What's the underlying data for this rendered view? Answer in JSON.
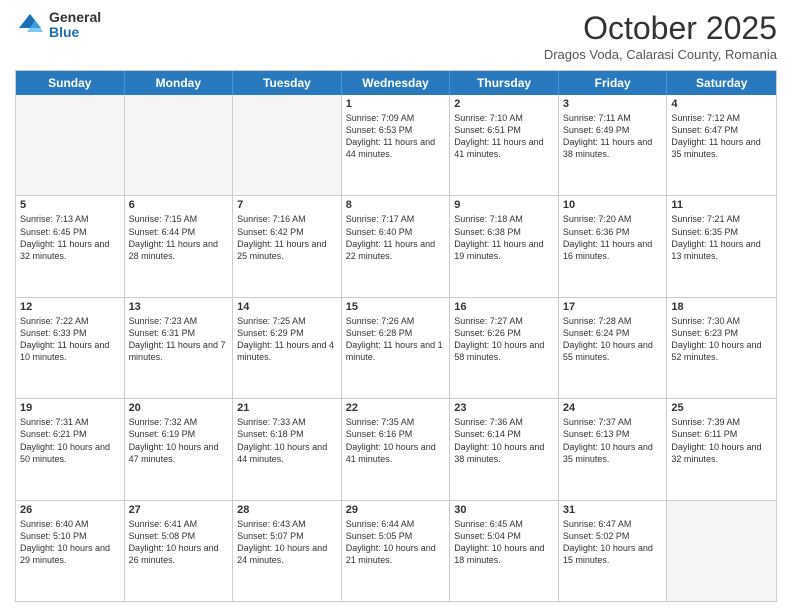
{
  "logo": {
    "general": "General",
    "blue": "Blue"
  },
  "header": {
    "month": "October 2025",
    "location": "Dragos Voda, Calarasi County, Romania"
  },
  "days": [
    "Sunday",
    "Monday",
    "Tuesday",
    "Wednesday",
    "Thursday",
    "Friday",
    "Saturday"
  ],
  "rows": [
    [
      {
        "day": "",
        "empty": true
      },
      {
        "day": "",
        "empty": true
      },
      {
        "day": "",
        "empty": true
      },
      {
        "day": "1",
        "sunrise": "7:09 AM",
        "sunset": "6:53 PM",
        "daylight": "11 hours and 44 minutes."
      },
      {
        "day": "2",
        "sunrise": "7:10 AM",
        "sunset": "6:51 PM",
        "daylight": "11 hours and 41 minutes."
      },
      {
        "day": "3",
        "sunrise": "7:11 AM",
        "sunset": "6:49 PM",
        "daylight": "11 hours and 38 minutes."
      },
      {
        "day": "4",
        "sunrise": "7:12 AM",
        "sunset": "6:47 PM",
        "daylight": "11 hours and 35 minutes."
      }
    ],
    [
      {
        "day": "5",
        "sunrise": "7:13 AM",
        "sunset": "6:45 PM",
        "daylight": "11 hours and 32 minutes."
      },
      {
        "day": "6",
        "sunrise": "7:15 AM",
        "sunset": "6:44 PM",
        "daylight": "11 hours and 28 minutes."
      },
      {
        "day": "7",
        "sunrise": "7:16 AM",
        "sunset": "6:42 PM",
        "daylight": "11 hours and 25 minutes."
      },
      {
        "day": "8",
        "sunrise": "7:17 AM",
        "sunset": "6:40 PM",
        "daylight": "11 hours and 22 minutes."
      },
      {
        "day": "9",
        "sunrise": "7:18 AM",
        "sunset": "6:38 PM",
        "daylight": "11 hours and 19 minutes."
      },
      {
        "day": "10",
        "sunrise": "7:20 AM",
        "sunset": "6:36 PM",
        "daylight": "11 hours and 16 minutes."
      },
      {
        "day": "11",
        "sunrise": "7:21 AM",
        "sunset": "6:35 PM",
        "daylight": "11 hours and 13 minutes."
      }
    ],
    [
      {
        "day": "12",
        "sunrise": "7:22 AM",
        "sunset": "6:33 PM",
        "daylight": "11 hours and 10 minutes."
      },
      {
        "day": "13",
        "sunrise": "7:23 AM",
        "sunset": "6:31 PM",
        "daylight": "11 hours and 7 minutes."
      },
      {
        "day": "14",
        "sunrise": "7:25 AM",
        "sunset": "6:29 PM",
        "daylight": "11 hours and 4 minutes."
      },
      {
        "day": "15",
        "sunrise": "7:26 AM",
        "sunset": "6:28 PM",
        "daylight": "11 hours and 1 minute."
      },
      {
        "day": "16",
        "sunrise": "7:27 AM",
        "sunset": "6:26 PM",
        "daylight": "10 hours and 58 minutes."
      },
      {
        "day": "17",
        "sunrise": "7:28 AM",
        "sunset": "6:24 PM",
        "daylight": "10 hours and 55 minutes."
      },
      {
        "day": "18",
        "sunrise": "7:30 AM",
        "sunset": "6:23 PM",
        "daylight": "10 hours and 52 minutes."
      }
    ],
    [
      {
        "day": "19",
        "sunrise": "7:31 AM",
        "sunset": "6:21 PM",
        "daylight": "10 hours and 50 minutes."
      },
      {
        "day": "20",
        "sunrise": "7:32 AM",
        "sunset": "6:19 PM",
        "daylight": "10 hours and 47 minutes."
      },
      {
        "day": "21",
        "sunrise": "7:33 AM",
        "sunset": "6:18 PM",
        "daylight": "10 hours and 44 minutes."
      },
      {
        "day": "22",
        "sunrise": "7:35 AM",
        "sunset": "6:16 PM",
        "daylight": "10 hours and 41 minutes."
      },
      {
        "day": "23",
        "sunrise": "7:36 AM",
        "sunset": "6:14 PM",
        "daylight": "10 hours and 38 minutes."
      },
      {
        "day": "24",
        "sunrise": "7:37 AM",
        "sunset": "6:13 PM",
        "daylight": "10 hours and 35 minutes."
      },
      {
        "day": "25",
        "sunrise": "7:39 AM",
        "sunset": "6:11 PM",
        "daylight": "10 hours and 32 minutes."
      }
    ],
    [
      {
        "day": "26",
        "sunrise": "6:40 AM",
        "sunset": "5:10 PM",
        "daylight": "10 hours and 29 minutes."
      },
      {
        "day": "27",
        "sunrise": "6:41 AM",
        "sunset": "5:08 PM",
        "daylight": "10 hours and 26 minutes."
      },
      {
        "day": "28",
        "sunrise": "6:43 AM",
        "sunset": "5:07 PM",
        "daylight": "10 hours and 24 minutes."
      },
      {
        "day": "29",
        "sunrise": "6:44 AM",
        "sunset": "5:05 PM",
        "daylight": "10 hours and 21 minutes."
      },
      {
        "day": "30",
        "sunrise": "6:45 AM",
        "sunset": "5:04 PM",
        "daylight": "10 hours and 18 minutes."
      },
      {
        "day": "31",
        "sunrise": "6:47 AM",
        "sunset": "5:02 PM",
        "daylight": "10 hours and 15 minutes."
      },
      {
        "day": "",
        "empty": true
      }
    ]
  ]
}
